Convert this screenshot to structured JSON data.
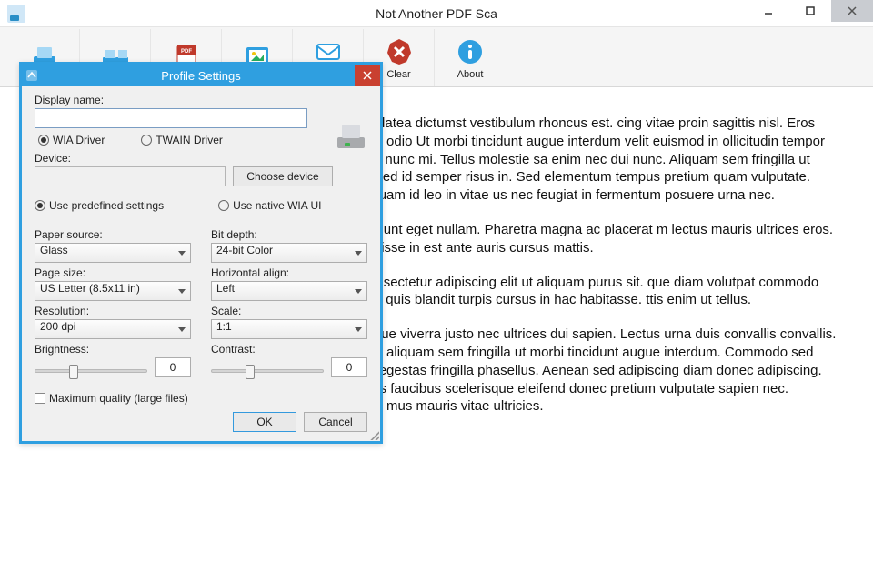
{
  "window": {
    "title": "Not Another PDF Sca"
  },
  "toolbar": {
    "items": [
      {
        "label": ""
      },
      {
        "label": ""
      },
      {
        "label": ""
      },
      {
        "label": ""
      },
      {
        "label": "PDF"
      },
      {
        "label": "Clear"
      },
      {
        "label": "About"
      }
    ]
  },
  "dialog": {
    "title": "Profile Settings",
    "display_name_label": "Display name:",
    "display_name_value": "",
    "driver_wia": "WIA Driver",
    "driver_twain": "TWAIN Driver",
    "device_label": "Device:",
    "device_value": "",
    "choose_device": "Choose device",
    "use_predefined": "Use predefined settings",
    "use_native": "Use native WIA UI",
    "paper_source_label": "Paper source:",
    "paper_source_value": "Glass",
    "page_size_label": "Page size:",
    "page_size_value": "US Letter (8.5x11 in)",
    "resolution_label": "Resolution:",
    "resolution_value": "200 dpi",
    "brightness_label": "Brightness:",
    "brightness_value": "0",
    "bit_depth_label": "Bit depth:",
    "bit_depth_value": "24-bit Color",
    "halign_label": "Horizontal align:",
    "halign_value": "Left",
    "scale_label": "Scale:",
    "scale_value": "1:1",
    "contrast_label": "Contrast:",
    "contrast_value": "0",
    "max_quality": "Maximum quality (large files)",
    "ok": "OK",
    "cancel": "Cancel"
  },
  "document": {
    "p1": "bitasse platea dictumst vestibulum rhoncus est. cing vitae proin sagittis nisl. Eros donec ac odio Ut morbi tincidunt augue interdum velit euismod in ollicitudin tempor id eu nisl nunc mi. Tellus molestie sa enim nec dui nunc. Aliquam sem fringilla ut morbi c sed id semper risus in. Sed elementum tempus pretium quam vulputate. Lectus quam id leo in vitae us nec feugiat in fermentum posuere urna nec.",
    "p2": "nisl tincidunt eget nullam. Pharetra magna ac placerat m lectus mauris ultrices eros. Suspendisse in est ante auris cursus mattis.",
    "p3": "amet consectetur adipiscing elit ut aliquam purus sit. que diam volutpat commodo sed. vida quis blandit turpis cursus in hac habitasse. ttis enim ut tellus.",
    "p4": "urna neque viverra justo nec ultrices dui sapien. Lectus urna duis convallis convallis. Mauris in aliquam sem fringilla ut morbi tincidunt augue interdum. Commodo sed egestas egestas fringilla phasellus. Aenean sed adipiscing diam donec adipiscing. Phasellus faucibus scelerisque eleifend donec pretium vulputate sapien nec. Ridiculus mus mauris vitae ultricies."
  }
}
